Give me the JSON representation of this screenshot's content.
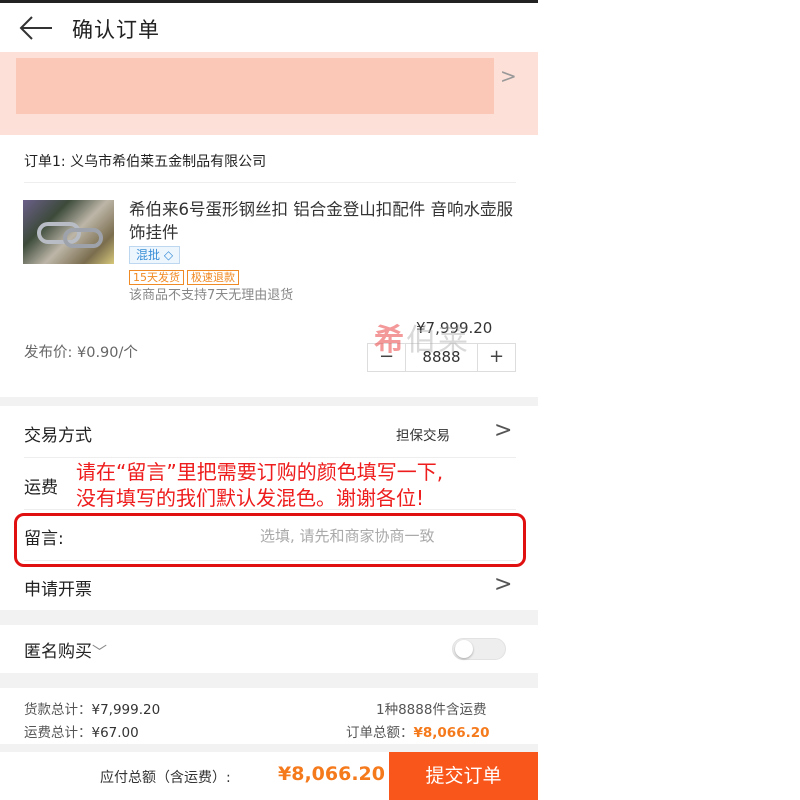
{
  "header": {
    "title": "确认订单"
  },
  "address_banner": {
    "arrow": ">"
  },
  "order": {
    "supplier": "订单1: 义乌市希伯莱五金制品有限公司",
    "product_title": "希伯来6号蛋形钢丝扣 铝合金登山扣配件 音响水壶服饰挂件",
    "tag_mix": "混批 ◇",
    "tag_ship": "15天发货",
    "tag_refund": "极速退款",
    "no_return": "该商品不支持7天无理由退货",
    "price": "¥7,999.20",
    "release_price": "发布价: ¥0.90/个",
    "quantity": "8888",
    "minus": "−",
    "plus": "+",
    "watermark_main": "希",
    "watermark_rest": "伯莱"
  },
  "options": {
    "trade_label": "交易方式",
    "trade_value": "担保交易",
    "shipping_label": "运费",
    "message_label": "留言:",
    "message_placeholder": "选填, 请先和商家协商一致",
    "invoice_label": "申请开票",
    "chevron": ">"
  },
  "anonymous": {
    "label": "匿名购买",
    "caret": "﹀"
  },
  "summary": {
    "goods_total_label": "货款总计：",
    "goods_total": "¥7,999.20",
    "shipping_total_label": "运费总计：",
    "shipping_total": "¥67.00",
    "count_text": "1种8888件含运费",
    "order_total_label": "订单总额：",
    "order_total": "¥8,066.20"
  },
  "footer": {
    "pay_label": "应付总额（含运费）:",
    "pay_amount": "¥8,066.20",
    "submit": "提交订单"
  },
  "annotation": {
    "line1": "请在“留言”里把需要订购的颜色填写一下,",
    "line2": "没有填写的我们默认发混色。谢谢各位!"
  },
  "colors": {
    "accent": "#f9561b",
    "price": "#f57a1c",
    "annotation": "#ee1c1c",
    "banner": "#fde0d8"
  }
}
